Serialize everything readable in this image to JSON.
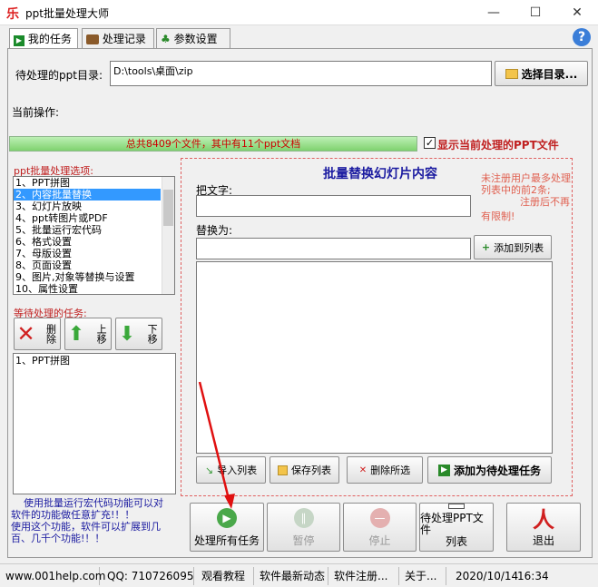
{
  "window": {
    "title": "ppt批量处理大师",
    "icon_glyph": "乐"
  },
  "tabs": [
    {
      "label": "我的任务",
      "icon": "play-icon"
    },
    {
      "label": "处理记录",
      "icon": "briefcase-icon"
    },
    {
      "label": "参数设置",
      "icon": "tree-icon"
    }
  ],
  "dir": {
    "label": "待处理的ppt目录:",
    "value": "D:\\tools\\桌面\\zip",
    "button": "选择目录..."
  },
  "current_op_label": "当前操作:",
  "progress": {
    "text": "总共8409个文件，其中有11个ppt文档",
    "fraction": 1.0
  },
  "show_current": {
    "label": "显示当前处理的PPT文件",
    "checked": true
  },
  "options": {
    "label": "ppt批量处理选项:",
    "items": [
      "1、PPT拼图",
      "2、内容批量替换",
      "3、幻灯片放映",
      "4、ppt转图片或PDF",
      "5、批量运行宏代码",
      "6、格式设置",
      "7、母版设置",
      "8、页面设置",
      "9、图片,对象等替换与设置",
      "10、属性设置"
    ],
    "selected_index": 1
  },
  "pending": {
    "label": "等待处理的任务:",
    "delete_label": "删除",
    "up_label": "上移",
    "down_label": "下移",
    "items": [
      "1、PPT拼图"
    ]
  },
  "tip": {
    "line1": "使用批量运行宏代码功能可以对",
    "line2": "软件的功能做任意扩充!！！",
    "line3": "使用这个功能，软件可以扩展到几",
    "line4": "百、几千个功能!！！"
  },
  "replace": {
    "title": "批量替换幻灯片内容",
    "notice1": "未注册用户最多处理",
    "notice2": "列表中的前2条;",
    "notice3": "注册后不再",
    "notice4": "有限制!",
    "from_label": "把文字:",
    "to_label": "替换为:",
    "add_to_list": "添加到列表",
    "import_list": "导入列表",
    "save_list": "保存列表",
    "delete_selected": "删除所选",
    "add_task": "添加为待处理任务"
  },
  "bottom": {
    "process_all": "处理所有任务",
    "pause": "暂停",
    "stop": "停止",
    "file_list_1": "待处理PPT文件",
    "file_list_2": "列表",
    "exit": "退出"
  },
  "status": {
    "website": "www.001help.com",
    "qq": "QQ:  710726095",
    "tutorial": "观看教程",
    "news": "软件最新动态",
    "register": "软件注册...",
    "about": "关于...",
    "date": "2020/10/14",
    "time": "16:34"
  },
  "colors": {
    "accent_red": "#c02020",
    "progress_green": "#7fd26f",
    "selection_blue": "#3399ff"
  }
}
